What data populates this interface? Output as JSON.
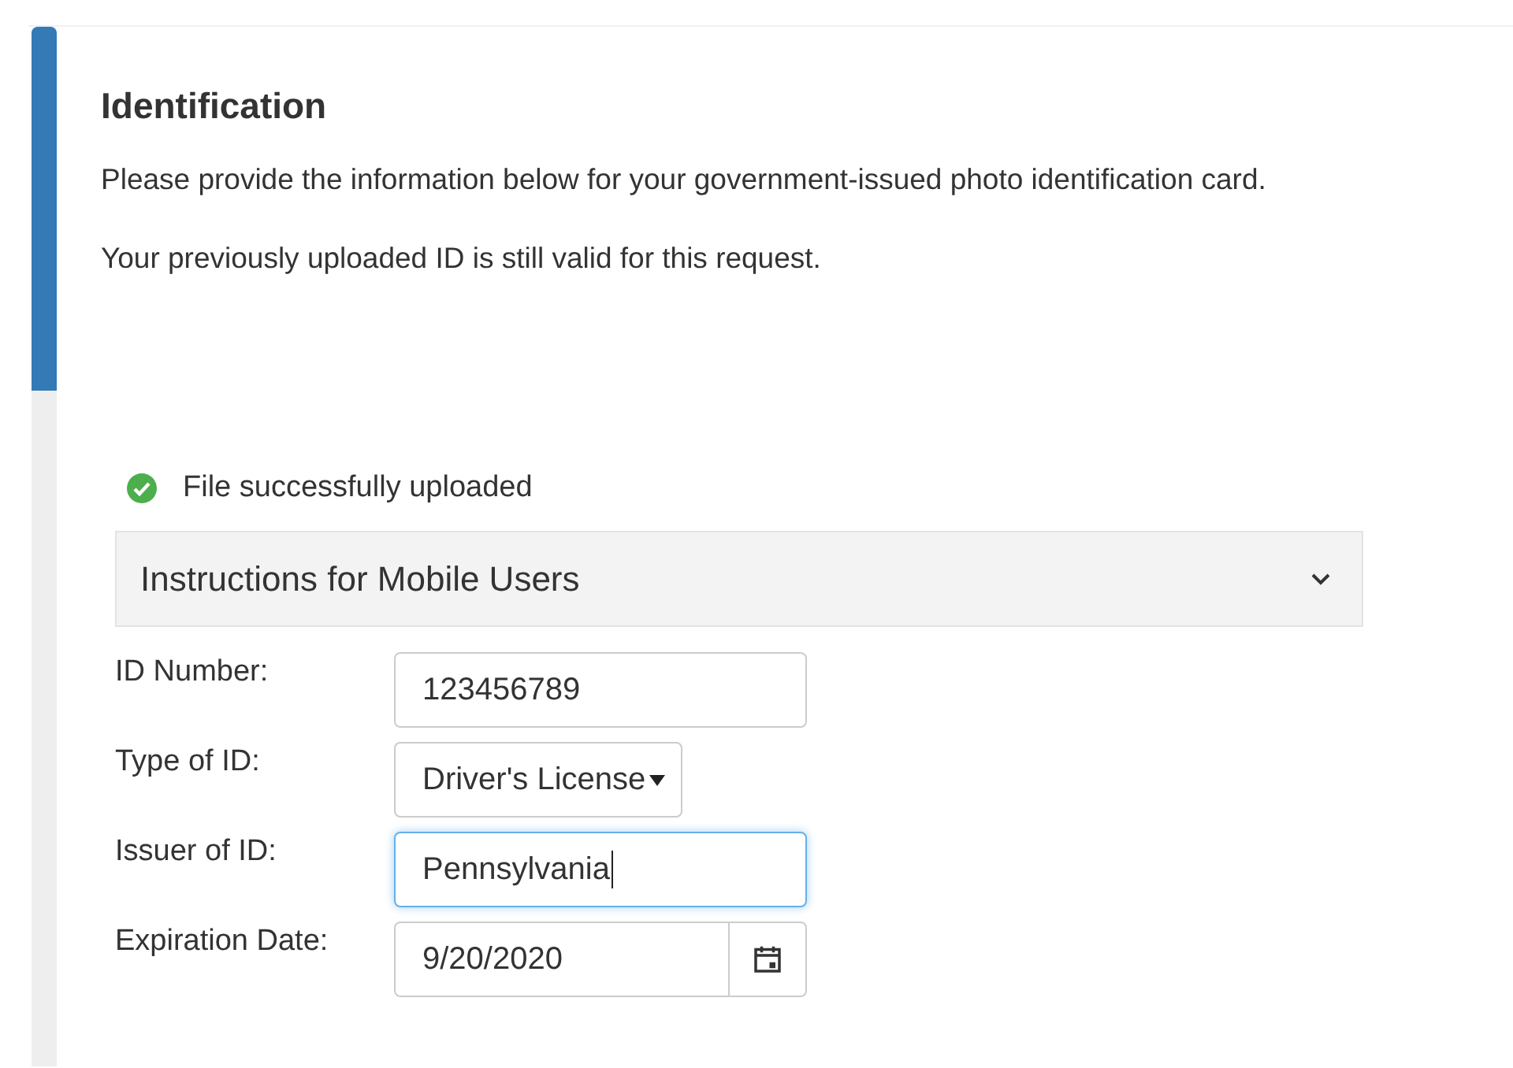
{
  "progress": {
    "level": 0.35
  },
  "section": {
    "title": "Identification",
    "paragraphs": [
      "Please provide the information below for your government-issued photo identification card.",
      "Your previously uploaded ID is still valid for this request."
    ]
  },
  "upload_status": {
    "kind": "success",
    "text": "File successfully uploaded"
  },
  "accordion": {
    "title": "Instructions for Mobile Users",
    "expanded": false
  },
  "fields": [
    {
      "label": "ID Number:",
      "kind": "text",
      "value": "123456789",
      "focused": false
    },
    {
      "label": "Type of ID:",
      "kind": "select",
      "value": "Driver's License",
      "focused": false
    },
    {
      "label": "Issuer of ID:",
      "kind": "text",
      "value": "Pennsylvania",
      "focused": true
    },
    {
      "label": "Expiration Date:",
      "kind": "date",
      "value": "9/20/2020",
      "focused": false
    }
  ]
}
